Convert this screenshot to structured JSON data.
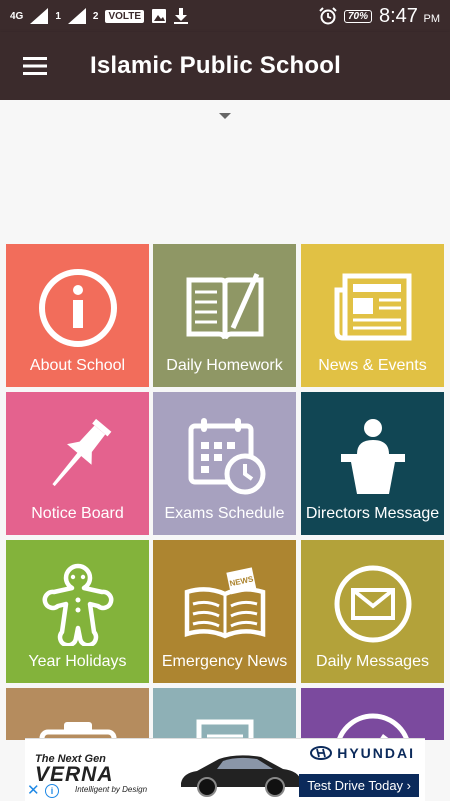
{
  "status_bar": {
    "network": "4G",
    "sim1": "1",
    "sim2": "2",
    "volte": "VOLTE",
    "battery": "70%",
    "time": "8:47",
    "ampm": "PM"
  },
  "app_bar": {
    "title": "Islamic Public School"
  },
  "tiles": [
    {
      "label": "About School",
      "color": "#f26d5b",
      "icon": "info-icon"
    },
    {
      "label": "Daily Homework",
      "color": "#8f9765",
      "icon": "book-pencil-icon"
    },
    {
      "label": "News & Events",
      "color": "#e1c144",
      "icon": "newspaper-icon"
    },
    {
      "label": "Notice Board",
      "color": "#e4628e",
      "icon": "pushpin-icon"
    },
    {
      "label": "Exams Schedule",
      "color": "#a7a1bf",
      "icon": "calendar-clock-icon"
    },
    {
      "label": "Directors Message",
      "color": "#114654",
      "icon": "podium-speaker-icon"
    },
    {
      "label": "Year Holidays",
      "color": "#83b33b",
      "icon": "gingerbread-icon"
    },
    {
      "label": "Emergency News",
      "color": "#ad8530",
      "icon": "news-paper-icon"
    },
    {
      "label": "Daily Messages",
      "color": "#b3a23a",
      "icon": "envelope-icon"
    },
    {
      "label": "",
      "color": "#b58c5e",
      "icon": "camera-icon"
    },
    {
      "label": "",
      "color": "#8eb0b6",
      "icon": "document-icon"
    },
    {
      "label": "",
      "color": "#7b4a9e",
      "icon": "edit-circle-icon"
    }
  ],
  "ad": {
    "headline": "The Next Gen",
    "model": "VERNA",
    "tagline": "Intelligent by Design",
    "brand": "HYUNDAI",
    "cta": "Test Drive Today ›",
    "close": "✕",
    "info": "i"
  }
}
